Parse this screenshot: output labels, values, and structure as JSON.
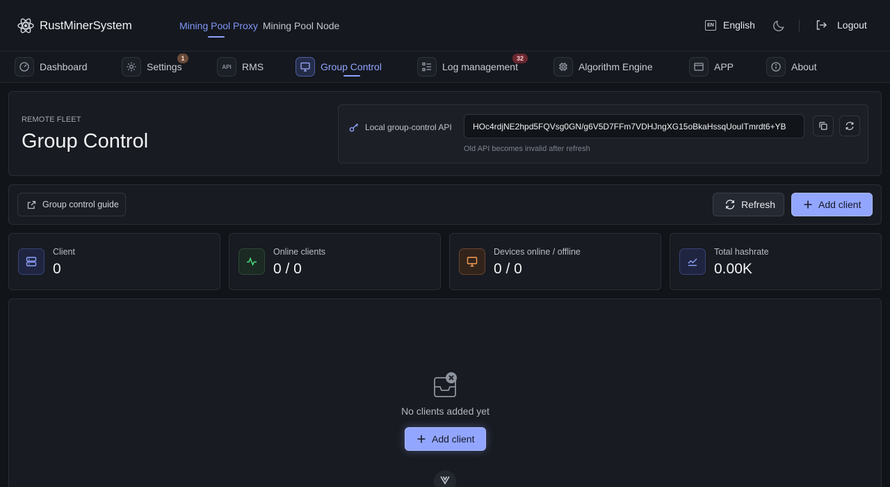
{
  "brand": {
    "name": "RustMinerSystem",
    "logo_icon": "atom-icon"
  },
  "top_nav": [
    {
      "label": "Mining Pool Proxy",
      "active": true
    },
    {
      "label": "Mining Pool Node",
      "active": false
    }
  ],
  "header_actions": {
    "language_badge": "EN",
    "language": "English",
    "theme_icon": "moon-icon",
    "logout_label": "Logout"
  },
  "nav": [
    {
      "label": "Dashboard",
      "icon": "gauge-icon"
    },
    {
      "label": "Settings",
      "icon": "gear-icon",
      "badge": "1"
    },
    {
      "label": "RMS",
      "icon": "api-icon",
      "icon_text": "API"
    },
    {
      "label": "Group Control",
      "icon": "monitor-icon",
      "active": true
    },
    {
      "label": "Log management",
      "icon": "log-list-icon",
      "badge": "32"
    },
    {
      "label": "Algorithm Engine",
      "icon": "chip-icon"
    },
    {
      "label": "APP",
      "icon": "window-icon"
    },
    {
      "label": "About",
      "icon": "info-icon"
    }
  ],
  "page": {
    "eyebrow": "REMOTE FLEET",
    "title": "Group Control"
  },
  "api": {
    "label": "Local group-control API",
    "value": "HOc4rdjNE2hpd5FQVsg0GN/g6V5D7FFm7VDHJngXG15oBkaHssqUouITmrdt6+YB",
    "hint": "Old API becomes invalid after refresh"
  },
  "toolbar": {
    "guide_label": "Group control guide",
    "refresh_label": "Refresh",
    "add_label": "Add client"
  },
  "stats": [
    {
      "label": "Client",
      "value": "0",
      "icon": "server-icon",
      "color": "#7f97f7"
    },
    {
      "label": "Online clients",
      "value": "0 / 0",
      "icon": "activity-icon",
      "color": "#4ade80"
    },
    {
      "label": "Devices online / offline",
      "value": "0 / 0",
      "icon": "monitor-icon",
      "color": "#f59e57"
    },
    {
      "label": "Total hashrate",
      "value": "0.00K",
      "icon": "trend-icon",
      "color": "#7f97f7"
    }
  ],
  "empty_state": {
    "message": "No clients added yet",
    "add_label": "Add client",
    "icon": "empty-inbox-icon"
  },
  "colors": {
    "accent": "#8fa3ff",
    "background": "#111419",
    "panel": "#181b21"
  }
}
